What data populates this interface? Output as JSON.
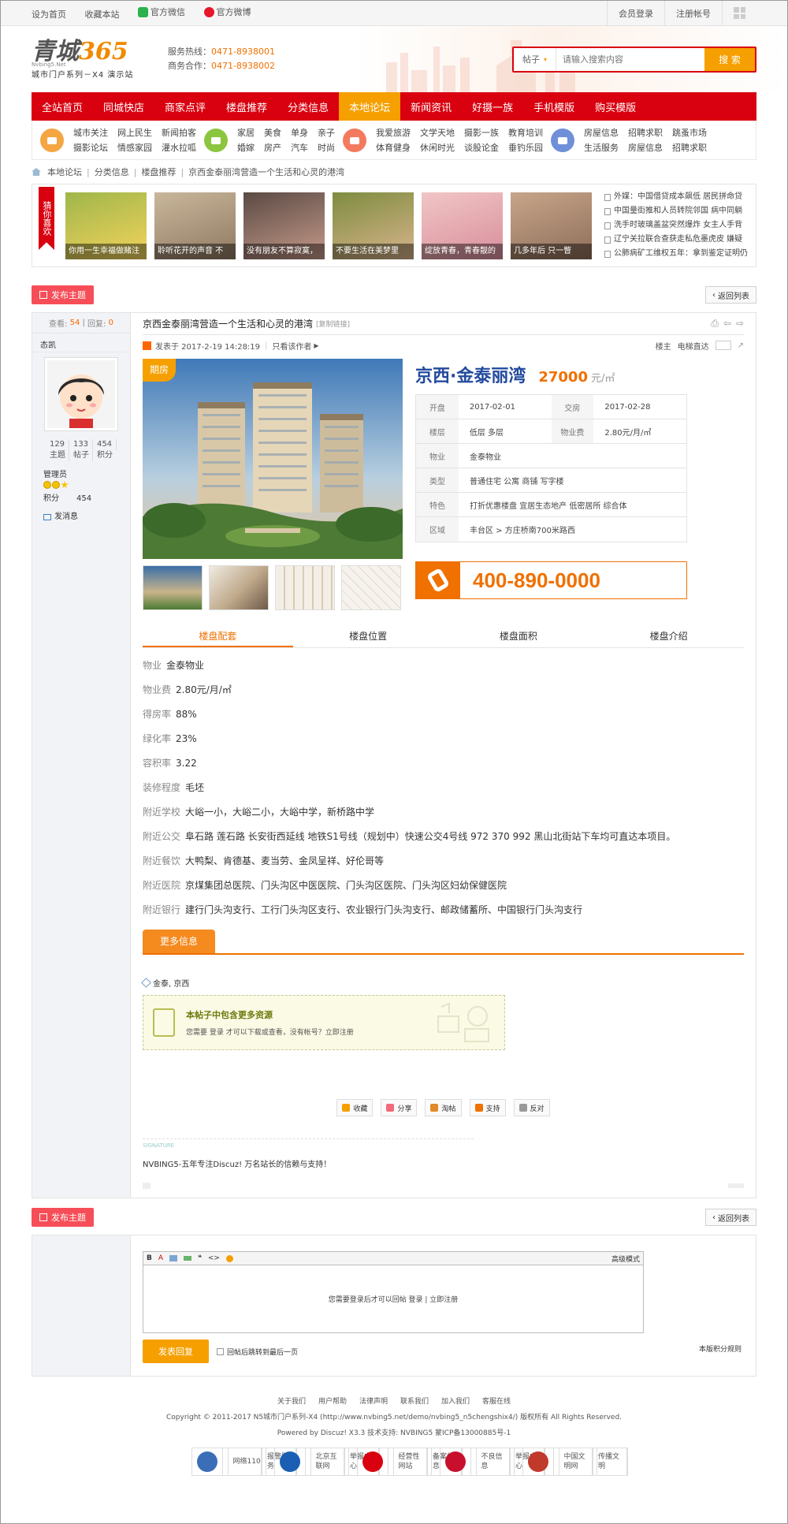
{
  "topbar": {
    "left": [
      "设为首页",
      "收藏本站",
      "官方微信",
      "官方微博"
    ],
    "login": "会员登录",
    "register": "注册帐号"
  },
  "header": {
    "logo_main1": "青城",
    "logo_main2": "365",
    "logo_small": "Nvbing5.Net",
    "logo_sub": "城市门户系列－X4 演示站",
    "service_label": "服务热线：",
    "service_phone": "0471-8938001",
    "biz_label": "商务合作：",
    "biz_phone": "0471-8938002",
    "search_type": "帖子",
    "search_placeholder": "请输入搜索内容",
    "search_button": "搜 索"
  },
  "nav": [
    "全站首页",
    "同城快店",
    "商家点评",
    "楼盘推荐",
    "分类信息",
    "本地论坛",
    "新闻资讯",
    "好摄一族",
    "手机模版",
    "购买模版"
  ],
  "subnav": [
    {
      "color": "#f5a642",
      "links": [
        "城市关注",
        "摄影论坛",
        "网上民生",
        "情感家园",
        "新闻拍客",
        "灌水拉呱"
      ]
    },
    {
      "color": "#8cc63f",
      "links": [
        "家居",
        "婚嫁",
        "美食",
        "房产",
        "单身",
        "汽车",
        "亲子",
        "时尚"
      ]
    },
    {
      "color": "#f47a5f",
      "links": [
        "我爱旅游",
        "体育健身",
        "文学天地",
        "休闲时光",
        "摄影一族",
        "谈股论金",
        "教育培训",
        "垂钓乐园"
      ]
    },
    {
      "color": "#6f8fd8",
      "links": [
        "房屋信息",
        "生活服务",
        "招聘求职",
        "房屋信息",
        "跳蚤市场",
        "招聘求职"
      ]
    }
  ],
  "breadcrumb": [
    "本地论坛",
    "分类信息",
    "楼盘推荐",
    "京西金泰丽湾营造一个生活和心灵的港湾"
  ],
  "recommend": {
    "tag": "猜你喜欢",
    "thumbs": [
      {
        "caption": "你用一生幸福做赌注",
        "c1": "#9fb64a",
        "c2": "#f3d35c"
      },
      {
        "caption": "聆听花开的声音 不",
        "c1": "#c9b79b",
        "c2": "#8f7a62"
      },
      {
        "caption": "没有朋友不算寂寞，",
        "c1": "#5a4a44",
        "c2": "#c69a8a"
      },
      {
        "caption": "不要生活在美梦里",
        "c1": "#7d8c3f",
        "c2": "#d9b48c"
      },
      {
        "caption": "绽放青春，青春靓的",
        "c1": "#f0c6c6",
        "c2": "#d98e9b"
      },
      {
        "caption": "几多年后 只一瞥",
        "c1": "#c7a58a",
        "c2": "#8f6e5a"
      }
    ],
    "news": [
      "外媒：中国借贷成本飙低 居民拼命贷",
      "中国量街推和人员转院邻国 病中同躺",
      "洗手时玻璃盖盆突然爆炸 女主人手背",
      "辽宁关拉联合查获走私危墨虎皮 嫌疑",
      "公肺病矿工维权五年：拿到鉴定证明仍"
    ]
  },
  "publish_button": "发布主题",
  "back_button": "返回列表",
  "post": {
    "views_label": "查看:",
    "views": "54",
    "replies_label": "回复:",
    "replies": "0",
    "author": "态凯",
    "user_stats": [
      {
        "n": "129",
        "l": "主题"
      },
      {
        "n": "133",
        "l": "帖子"
      },
      {
        "n": "454",
        "l": "积分"
      }
    ],
    "group": "管理员",
    "credit_label": "积分",
    "credit": "454",
    "message": "发消息",
    "title": "京西金泰丽湾营造一个生活和心灵的港湾",
    "copy_link": "[复制链接]",
    "posted": "发表于 2017-2-19 14:28:19",
    "only_author": "只看该作者",
    "floor_label": "楼主",
    "direct_label": "电梯直达"
  },
  "property": {
    "badge": "期房",
    "name": "京西·金泰丽湾",
    "price": "27000",
    "unit": "元/㎡",
    "rows": [
      [
        {
          "k": "开盘",
          "v": "2017-02-01"
        },
        {
          "k": "交房",
          "v": "2017-02-28"
        }
      ],
      [
        {
          "k": "楼层",
          "v": "低层 多层"
        },
        {
          "k": "物业费",
          "v": "2.80元/月/㎡"
        }
      ],
      [
        {
          "k": "物业",
          "v": "金泰物业"
        }
      ],
      [
        {
          "k": "类型",
          "v": "普通住宅 公寓 商铺 写字楼"
        }
      ],
      [
        {
          "k": "特色",
          "v": "打折优惠楼盘 宜居生态地产 低密居所 综合体"
        }
      ],
      [
        {
          "k": "区域",
          "v": "丰台区 > 方庄桥南700米路西"
        }
      ]
    ],
    "phone": "400-890-0000",
    "tabs": [
      "楼盘配套",
      "楼盘位置",
      "楼盘面积",
      "楼盘介绍"
    ],
    "attrs": [
      {
        "k": "物业",
        "v": "金泰物业"
      },
      {
        "k": "物业费",
        "v": "2.80元/月/㎡"
      },
      {
        "k": "得房率",
        "v": "88%"
      },
      {
        "k": "绿化率",
        "v": "23%"
      },
      {
        "k": "容积率",
        "v": "3.22"
      },
      {
        "k": "装修程度",
        "v": "毛坯"
      },
      {
        "k": "附近学校",
        "v": "大峪一小，大峪二小，大峪中学，新桥路中学"
      },
      {
        "k": "附近公交",
        "v": "阜石路 莲石路 长安街西延线 地铁S1号线（规划中）快速公交4号线 972 370 992 黑山北街站下车均可直达本项目。"
      },
      {
        "k": "附近餐饮",
        "v": "大鸭梨、肯德基、麦当劳、金凤呈祥、好伦哥等"
      },
      {
        "k": "附近医院",
        "v": "京煤集团总医院、门头沟区中医医院、门头沟区医院、门头沟区妇幼保健医院"
      },
      {
        "k": "附近银行",
        "v": "建行门头沟支行、工行门头沟区支行、农业银行门头沟支行、邮政储蓄所、中国银行门头沟支行"
      }
    ],
    "more_info": "更多信息"
  },
  "tags": "金泰, 京西",
  "locked": {
    "title": "本帖子中包含更多资源",
    "text": "您需要 登录 才可以下载或查看，没有帐号？立即注册"
  },
  "actions": [
    "收藏",
    "分享",
    "淘帖",
    "支持",
    "反对"
  ],
  "signature": {
    "label": "SIGNATURE",
    "text": "NVBING5-五年专注Discuz! 万名站长的信赖与支持！"
  },
  "reply": {
    "toolbar_mode": "高级模式",
    "area_text": "您需要登录后才可以回帖 登录 | 立即注册",
    "submit": "发表回复",
    "checkbox": "回帖后跳转到最后一页",
    "rules": "本版积分规则"
  },
  "footer": {
    "links": [
      "关于我们",
      "用户帮助",
      "法律声明",
      "联系我们",
      "加入我们",
      "客服在线"
    ],
    "copyright": "Copyright © 2011-2017 N5城市门户系列-X4 (http://www.nvbing5.net/demo/nvbing5_n5chengshix4/) 版权所有 All Rights Reserved.",
    "powered": "Powered by Discuz! X3.3 技术支持: NVBING5 蒙ICP备13000885号-1",
    "badges": [
      {
        "t1": "网络110",
        "t2": "报警服务",
        "color": "#3a6fb8"
      },
      {
        "t1": "北京互联网",
        "t2": "举报中心",
        "color": "#1a5fb4"
      },
      {
        "t1": "经营性网站",
        "t2": "备案信息",
        "color": "#d9000f"
      },
      {
        "t1": "不良信息",
        "t2": "举报中心",
        "color": "#c8102e"
      },
      {
        "t1": "中国文明网",
        "t2": "传播文明",
        "color": "#c0392b"
      }
    ]
  }
}
